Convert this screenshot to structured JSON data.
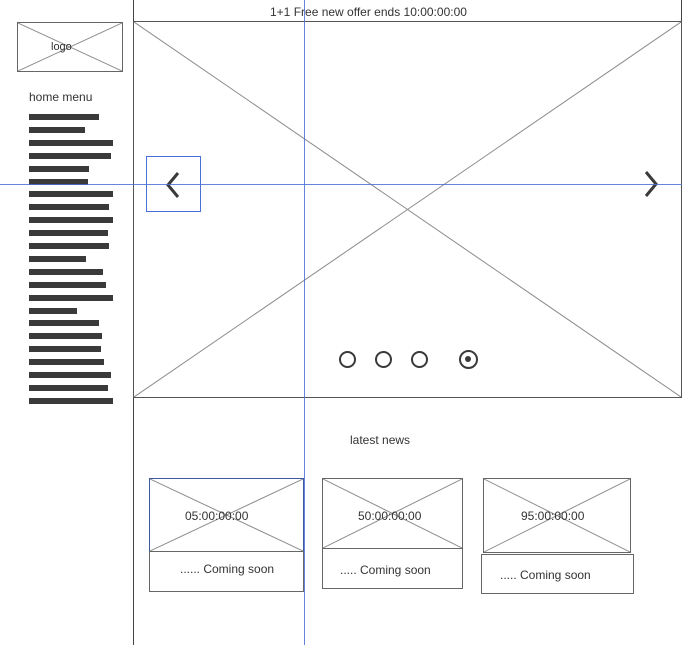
{
  "promo_banner": {
    "text": "1+1 Free new offer ends 10:00:00:00"
  },
  "logo": {
    "label": "logo"
  },
  "sidebar": {
    "title": "home menu",
    "menu_item_count": 23
  },
  "carousel": {
    "prev_icon": "chevron-left-icon",
    "next_icon": "chevron-right-icon",
    "slide_count": 4,
    "active_slide": 4
  },
  "news": {
    "title": "latest news",
    "cards": [
      {
        "timer": "05:00:00:00",
        "caption": "...... Coming soon"
      },
      {
        "timer": "50:00:00:00",
        "caption": "..... Coming soon"
      },
      {
        "timer": "95:00:00:00",
        "caption": "..... Coming soon"
      }
    ]
  },
  "colors": {
    "guide": "#4a6fd6",
    "wire": "#8a8a8a",
    "ink": "#3a3a3a"
  }
}
